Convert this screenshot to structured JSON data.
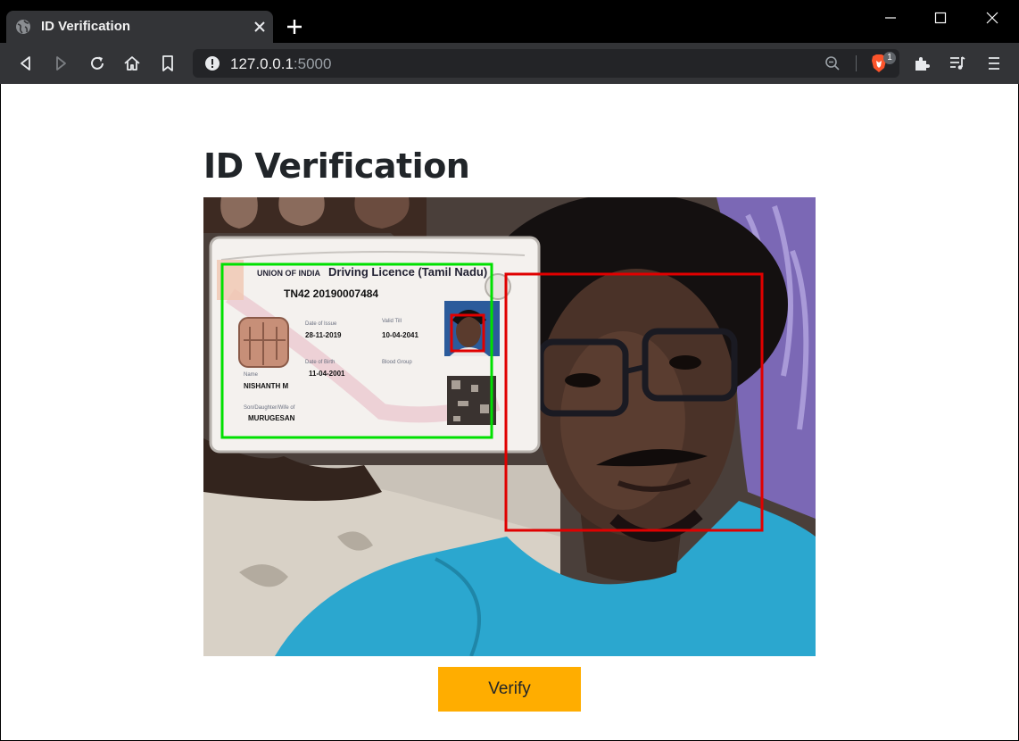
{
  "browser": {
    "tab_title": "ID Verification",
    "url_host": "127.0.0.1",
    "url_port": ":5000",
    "shields_count": "1"
  },
  "page": {
    "title": "ID Verification",
    "verify_label": "Verify"
  },
  "card": {
    "header": "UNION OF INDIA  Driving Licence (Tamil Nadu)",
    "number": "TN42 20190007484",
    "date_of_issue": "28-11-2019",
    "valid_till": "10-04-2041",
    "date_of_birth": "11-04-2001",
    "name": "NISHANTH M",
    "relation_name": "MURUGESAN"
  },
  "detection": {
    "card_box_color": "#00e000",
    "face_box_color": "#e00000"
  }
}
